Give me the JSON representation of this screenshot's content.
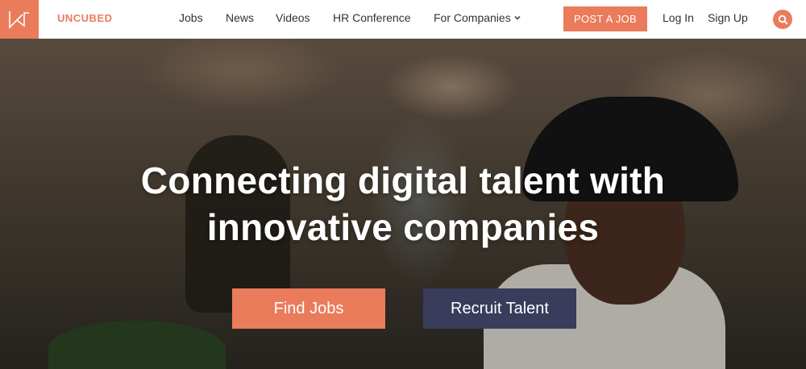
{
  "brand": {
    "name": "UNCUBED",
    "accent_color": "#ea7b5b",
    "logo_icon": "uncubed-logo-icon"
  },
  "nav": {
    "jobs": "Jobs",
    "news": "News",
    "videos": "Videos",
    "hr_conference": "HR Conference",
    "for_companies": "For Companies",
    "for_companies_icon": "chevron-down-icon"
  },
  "actions": {
    "post_job": "POST A JOB",
    "log_in": "Log In",
    "sign_up": "Sign Up",
    "search_icon": "search-icon"
  },
  "hero": {
    "headline_line1": "Connecting digital talent with",
    "headline_line2": "innovative companies",
    "find_jobs": "Find Jobs",
    "recruit_talent": "Recruit Talent",
    "secondary_color": "#3a3c5b"
  }
}
